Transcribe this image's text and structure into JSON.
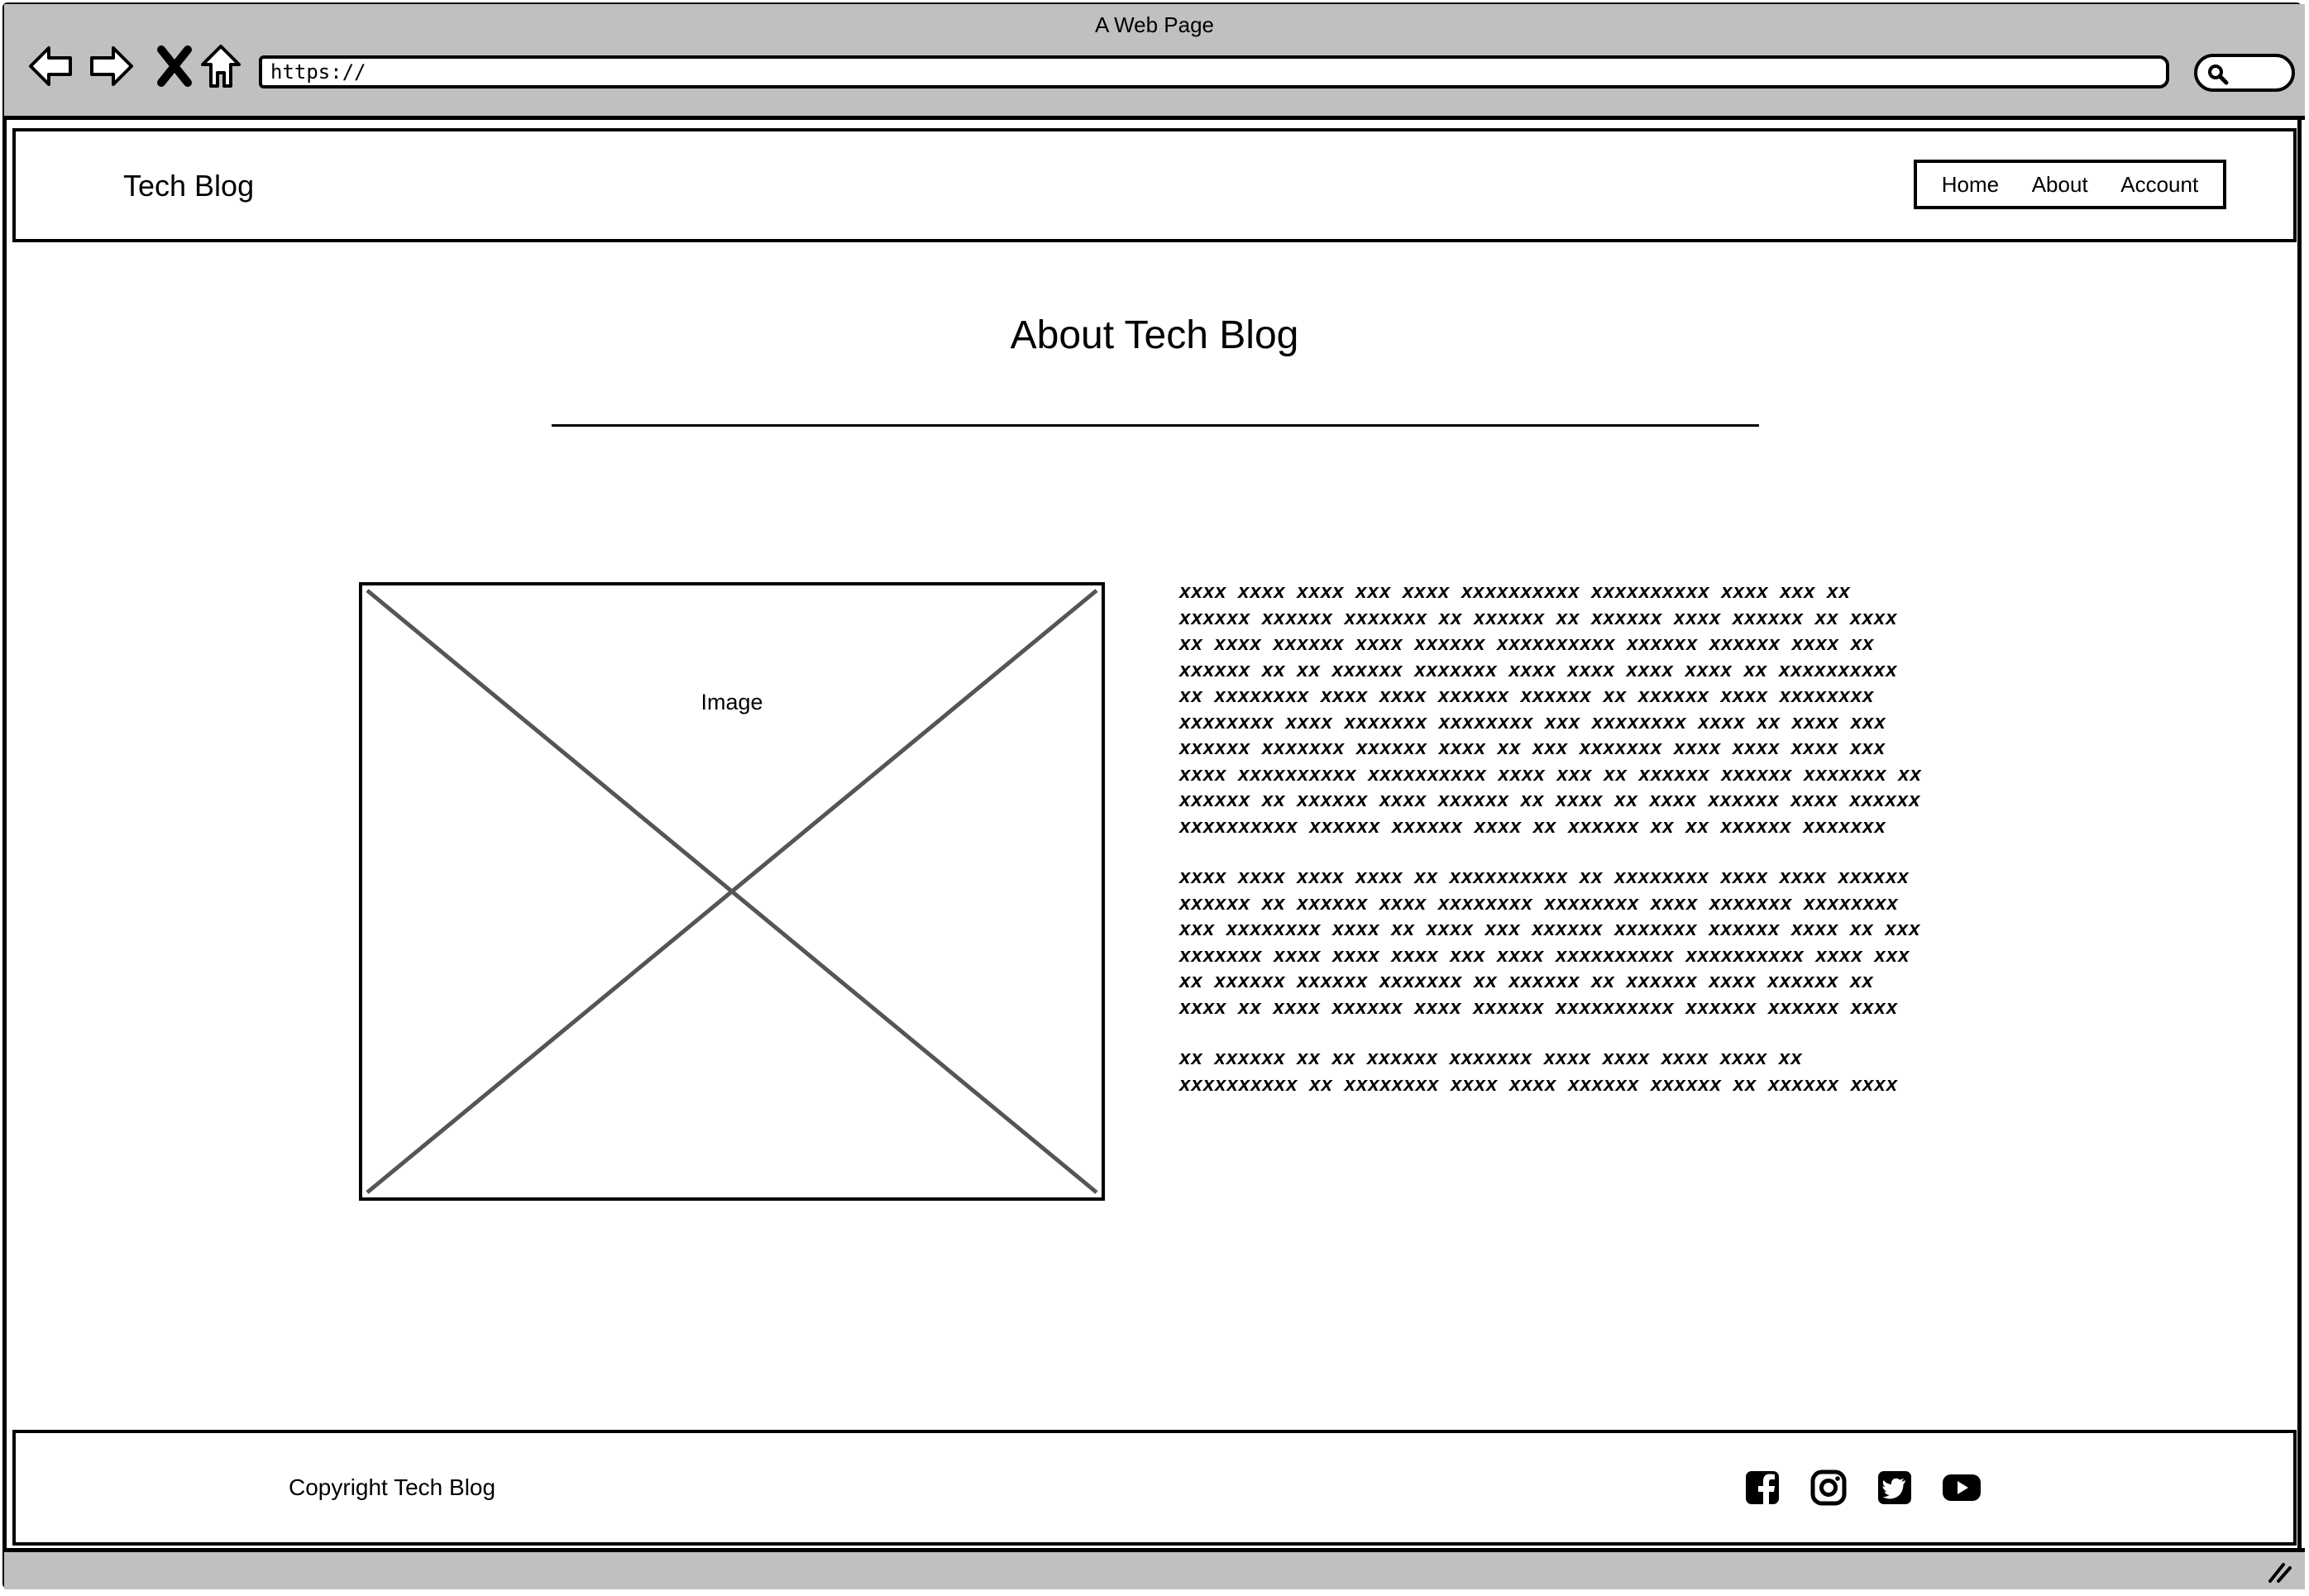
{
  "window": {
    "title": "A Web Page"
  },
  "address_bar": {
    "url": "https://"
  },
  "header": {
    "brand": "Tech Blog",
    "nav": [
      {
        "label": "Home"
      },
      {
        "label": "About"
      },
      {
        "label": "Account"
      }
    ]
  },
  "main": {
    "title": "About Tech Blog",
    "image_label": "Image",
    "paragraphs": [
      "xxxx xxxx xxxx xxx xxxx xxxxxxxxxx xxxxxxxxxx xxxx xxx xx xxxxxx xxxxxx xxxxxxx xx xxxxxx xx xxxxxx xxxx xxxxxx xx xxxx xx xxxx xxxxxx xxxx xxxxxx xxxxxxxxxx xxxxxx xxxxxx xxxx xx xxxxxx xx xx xxxxxx xxxxxxx xxxx xxxx xxxx xxxx xx xxxxxxxxxx xx xxxxxxxx xxxx xxxx xxxxxx xxxxxx xx xxxxxx xxxx xxxxxxxx xxxxxxxx xxxx xxxxxxx xxxxxxxx xxx xxxxxxxx xxxx xx xxxx xxx xxxxxx xxxxxxx xxxxxx xxxx xx xxx xxxxxxx xxxx xxxx xxxx xxx xxxx xxxxxxxxxx xxxxxxxxxx xxxx xxx xx xxxxxx xxxxxx xxxxxxx xx xxxxxx xx xxxxxx xxxx xxxxxx xx xxxx xx xxxx xxxxxx xxxx xxxxxx xxxxxxxxxx xxxxxx xxxxxx xxxx xx xxxxxx xx xx xxxxxx xxxxxxx",
      "xxxx xxxx xxxx xxxx xx xxxxxxxxxx xx xxxxxxxx xxxx xxxx xxxxxx xxxxxx xx xxxxxx xxxx xxxxxxxx xxxxxxxx xxxx xxxxxxx xxxxxxxx xxx xxxxxxxx xxxx xx xxxx xxx xxxxxx xxxxxxx xxxxxx xxxx xx xxx xxxxxxx xxxx xxxx xxxx xxx xxxx xxxxxxxxxx xxxxxxxxxx xxxx xxx xx xxxxxx xxxxxx xxxxxxx xx xxxxxx xx xxxxxx xxxx xxxxxx xx xxxx xx xxxx xxxxxx xxxx xxxxxx xxxxxxxxxx xxxxxx xxxxxx xxxx",
      "xx xxxxxx xx xx xxxxxx xxxxxxx xxxx xxxx xxxx xxxx xx xxxxxxxxxx xx xxxxxxxx xxxx xxxx xxxxxx xxxxxx xx xxxxxx xxxx"
    ]
  },
  "footer": {
    "copyright": "Copyright Tech Blog",
    "social_icons": [
      "facebook-icon",
      "instagram-icon",
      "twitter-icon",
      "youtube-icon"
    ]
  }
}
